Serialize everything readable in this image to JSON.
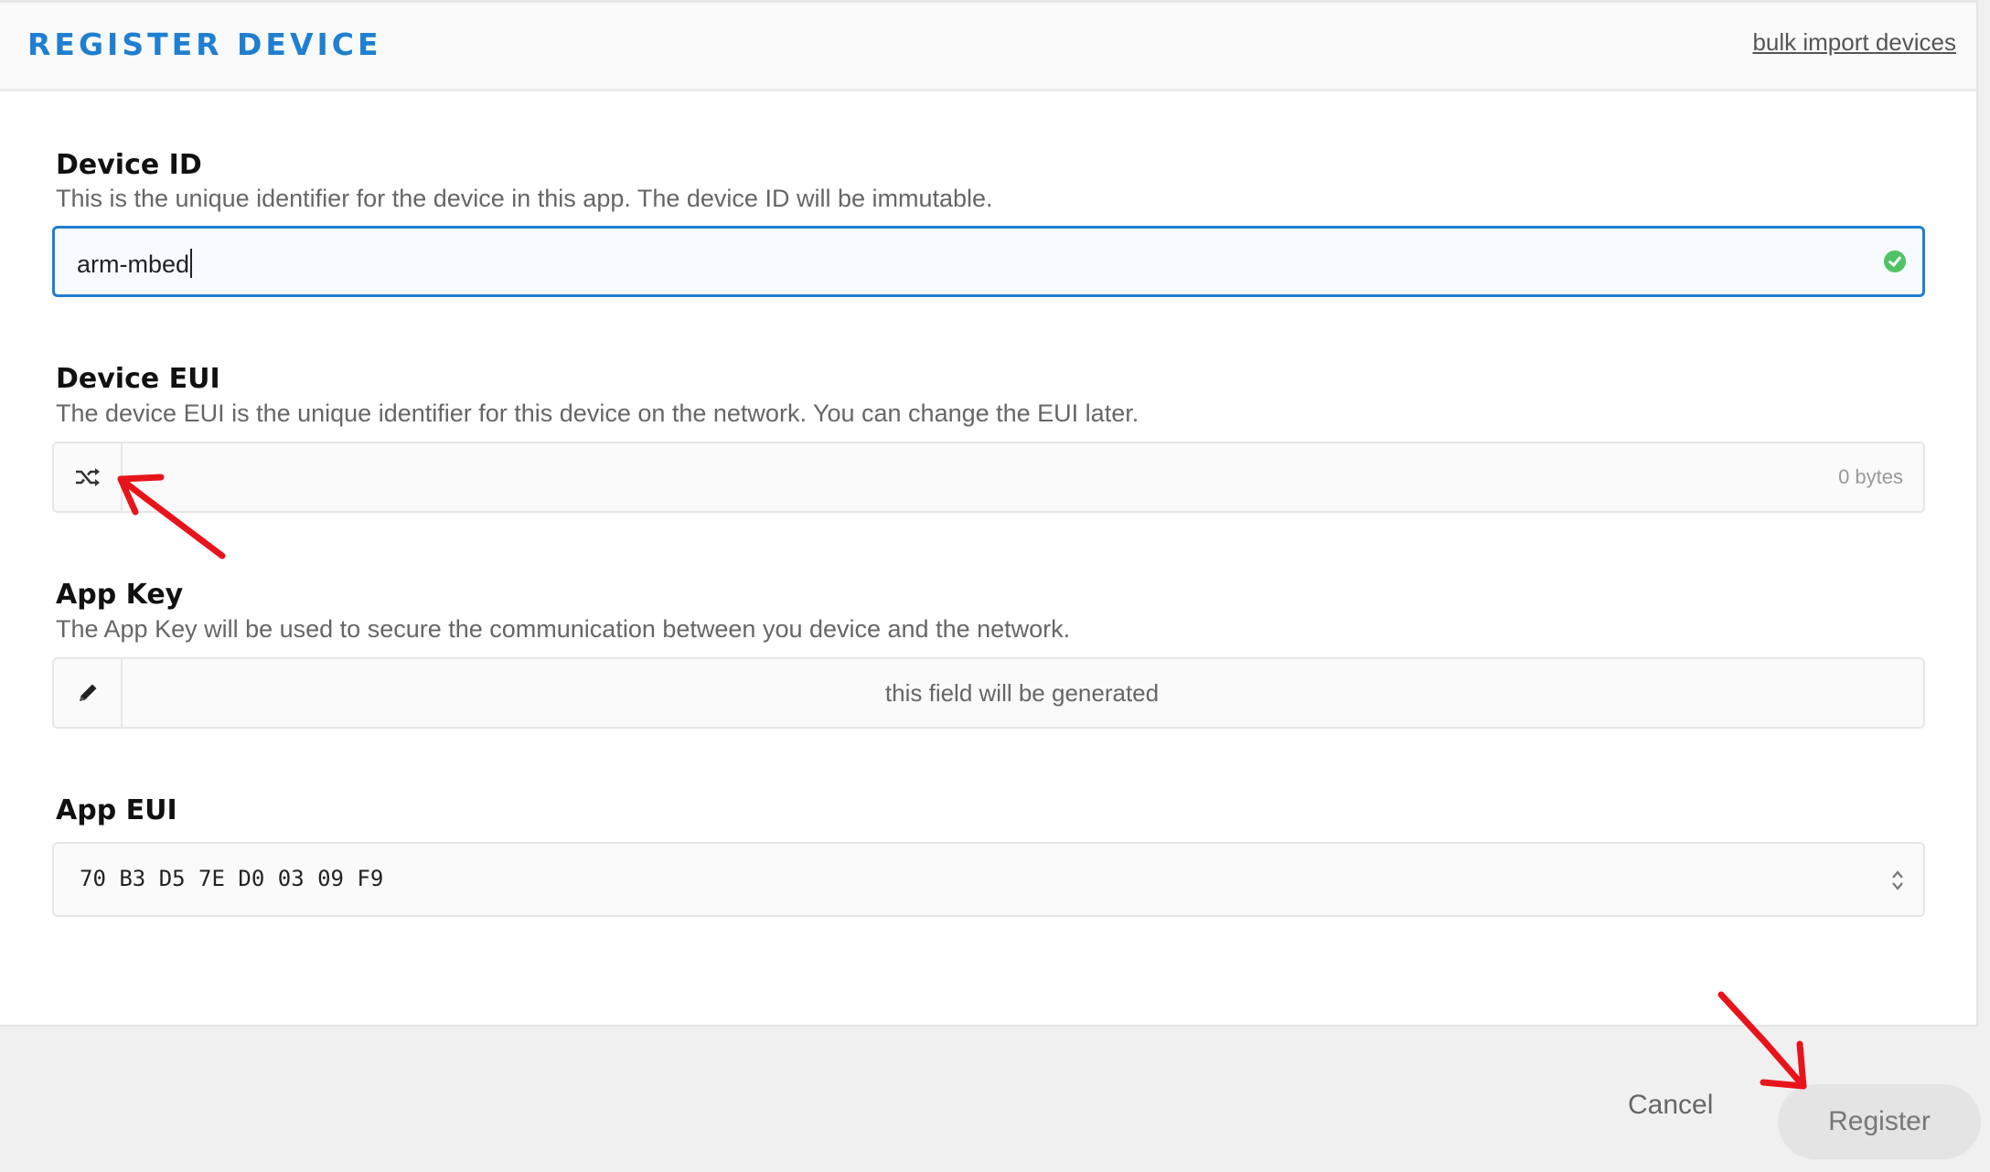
{
  "header": {
    "title": "REGISTER DEVICE",
    "bulk_import_link": "bulk import devices"
  },
  "fields": {
    "device_id": {
      "label": "Device ID",
      "description": "This is the unique identifier for the device in this app. The device ID will be immutable.",
      "value": "arm-mbed",
      "status_icon": "check-circle-icon"
    },
    "device_eui": {
      "label": "Device EUI",
      "description": "The device EUI is the unique identifier for this device on the network. You can change the EUI later.",
      "byte_count": "0 bytes",
      "addon_icon": "shuffle-icon"
    },
    "app_key": {
      "label": "App Key",
      "description": "The App Key will be used to secure the communication between you device and the network.",
      "placeholder": "this field will be generated",
      "addon_icon": "pencil-icon"
    },
    "app_eui": {
      "label": "App EUI",
      "value": "70 B3 D5 7E D0 03 09 F9",
      "select_icon": "up-down-chevron-icon"
    }
  },
  "actions": {
    "cancel_label": "Cancel",
    "register_label": "Register"
  },
  "annotations": {
    "arrow_color": "#e8141b",
    "arrow_icon": "red-arrow-annotation"
  },
  "colors": {
    "accent": "#1f7fd0",
    "valid": "#4fc366"
  }
}
